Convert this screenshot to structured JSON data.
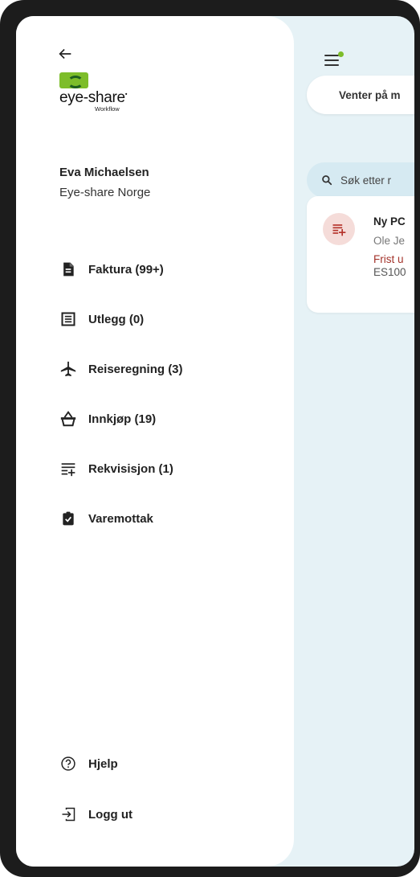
{
  "background_app": {
    "tab_label": "Venter på m",
    "search_placeholder": "Søk etter r",
    "card": {
      "title": "Ny PC",
      "subtitle": "Ole Je",
      "due": "Frist u",
      "id": "ES100"
    }
  },
  "logo": {
    "word": "eye-share",
    "sub": "Workflow"
  },
  "user": {
    "name": "Eva Michaelsen",
    "org": "Eye-share Norge"
  },
  "nav": [
    {
      "label": "Faktura (99+)",
      "icon": "invoice-document-icon"
    },
    {
      "label": "Utlegg (0)",
      "icon": "receipt-icon"
    },
    {
      "label": "Reiseregning (3)",
      "icon": "airplane-icon"
    },
    {
      "label": "Innkjøp (19)",
      "icon": "shopping-basket-icon"
    },
    {
      "label": "Rekvisisjon (1)",
      "icon": "list-add-icon"
    },
    {
      "label": "Varemottak",
      "icon": "clipboard-check-icon"
    }
  ],
  "footer": [
    {
      "label": "Hjelp",
      "icon": "help-circle-icon"
    },
    {
      "label": "Logg ut",
      "icon": "logout-icon"
    }
  ],
  "colors": {
    "brand_green": "#7dbd2a",
    "app_background": "#e6f2f6",
    "due_text": "#a3322a"
  }
}
